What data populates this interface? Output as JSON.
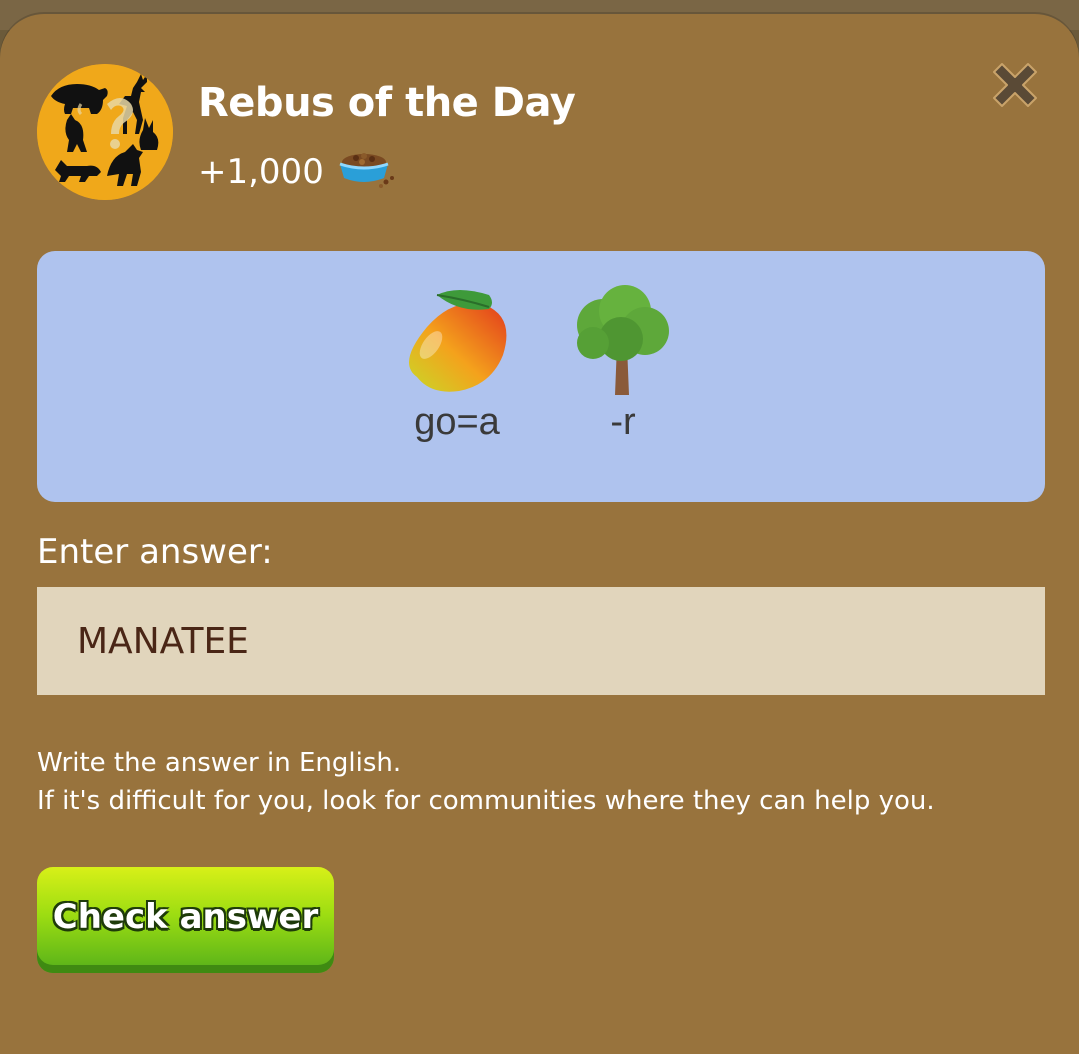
{
  "dialog": {
    "title": "Rebus of the Day",
    "reward_amount": "+1,000",
    "reward_icon": "pet-food-bowl-icon",
    "avatar_icon": "animal-silhouettes-question-icon",
    "close_icon": "close-icon"
  },
  "puzzle": {
    "items": [
      {
        "icon": "mango-emoji",
        "label": "go=a"
      },
      {
        "icon": "tree-emoji",
        "label": "-r"
      }
    ]
  },
  "answer": {
    "label": "Enter answer:",
    "value": "MANATEE"
  },
  "hint": {
    "line1": "Write the answer in English.",
    "line2": "If it's difficult for you, look for communities where they can help you."
  },
  "actions": {
    "check_label": "Check answer"
  },
  "colors": {
    "modal_bg": "#98733d",
    "puzzle_bg": "#afc3ee",
    "input_bg": "#e1d5bc",
    "input_text": "#4a2616",
    "button_green": "#7cc916"
  }
}
